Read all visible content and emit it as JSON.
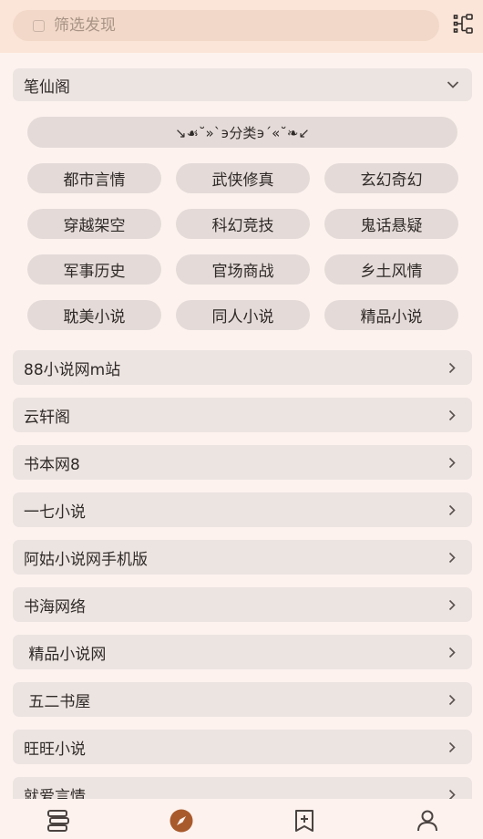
{
  "search": {
    "placeholder": "筛选发现"
  },
  "group": {
    "title": "笔仙阁"
  },
  "category_banner": "↘☙˘»`϶分类϶´«˘❧↙",
  "tags": [
    "都市言情",
    "武侠修真",
    "玄幻奇幻",
    "穿越架空",
    "科幻竞技",
    "鬼话悬疑",
    "军事历史",
    "官场商战",
    "乡土风情",
    "耽美小说",
    "同人小说",
    "精品小说"
  ],
  "sites": [
    "88小说网m站",
    "云轩阁",
    "书本网8",
    "一七小说",
    "阿姑小说网手机版",
    "书海网络",
    " 精品小说网",
    " 五二书屋",
    "旺旺小说",
    "就爱言情"
  ],
  "colors": {
    "accent": "#a85a2c",
    "background": "#fdf2ee",
    "topbar": "#fbe5d8",
    "row": "#ece4e1",
    "chip": "#e4dbd8"
  },
  "bottom_nav": {
    "items": [
      "bookshelf-icon",
      "explore-icon",
      "rss-bookmark-icon",
      "profile-icon"
    ],
    "active": "explore-icon"
  }
}
